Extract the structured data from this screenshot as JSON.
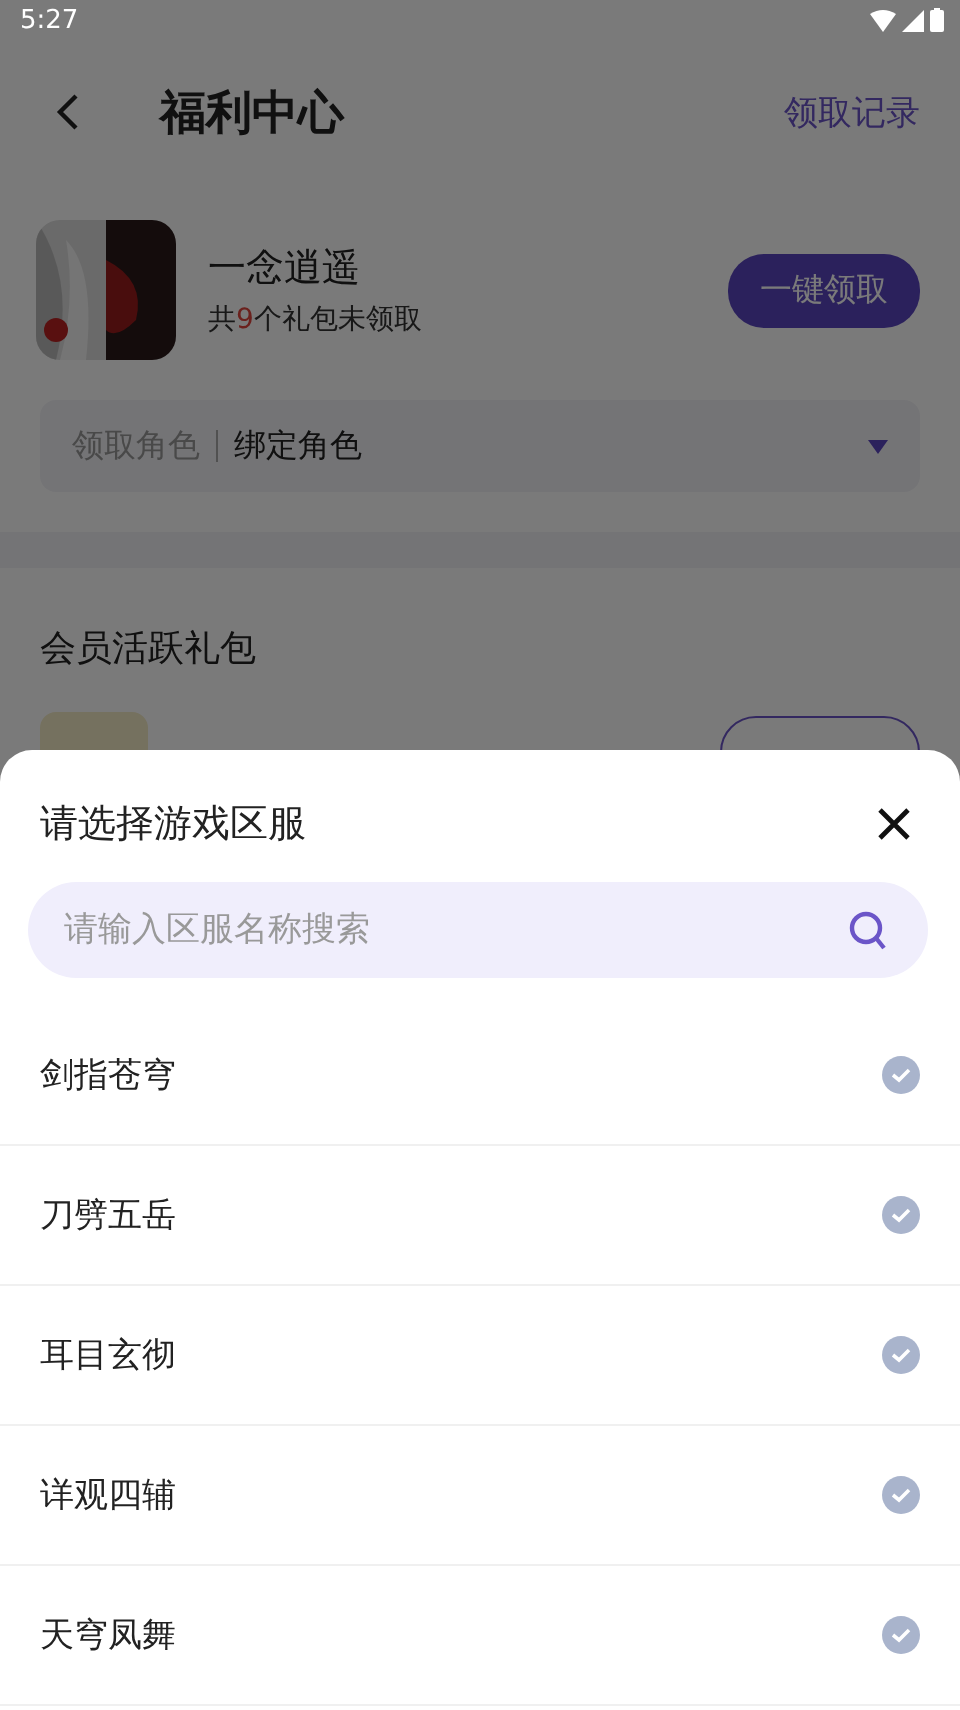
{
  "status_bar": {
    "time": "5:27"
  },
  "header": {
    "title": "福利中心",
    "action": "领取记录"
  },
  "game": {
    "name": "一念逍遥",
    "gifts_prefix": "共",
    "gift_count": "9",
    "gifts_suffix": "个礼包未领取",
    "claim_button": "一键领取"
  },
  "role_select": {
    "label": "领取角色",
    "value": "绑定角色"
  },
  "section": {
    "title": "会员活跃礼包"
  },
  "sheet": {
    "title": "请选择游戏区服",
    "search": {
      "placeholder": "请输入区服名称搜索"
    },
    "servers": [
      {
        "name": "剑指苍穹",
        "selected": false
      },
      {
        "name": "刀劈五岳",
        "selected": false
      },
      {
        "name": "耳目玄彻",
        "selected": false
      },
      {
        "name": "详观四辅",
        "selected": false
      },
      {
        "name": "天穹凤舞",
        "selected": false
      }
    ]
  }
}
